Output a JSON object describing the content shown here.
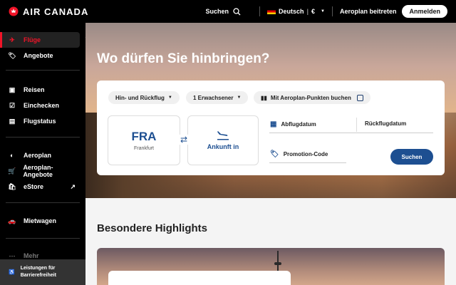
{
  "header": {
    "brand": "AIR CANADA",
    "search_label": "Suchen",
    "language": "Deutsch",
    "currency": "€",
    "aeroplan_join": "Aeroplan beitreten",
    "login": "Anmelden"
  },
  "sidebar": {
    "items": [
      {
        "label": "Flüge",
        "icon": "plane-icon"
      },
      {
        "label": "Angebote",
        "icon": "tag-icon"
      },
      {
        "label": "Reisen",
        "icon": "suitcase-icon"
      },
      {
        "label": "Einchecken",
        "icon": "checkin-icon"
      },
      {
        "label": "Flugstatus",
        "icon": "status-icon"
      },
      {
        "label": "Aeroplan",
        "icon": "aeroplan-icon"
      },
      {
        "label": "Aeroplan-Angebote",
        "icon": "cart-icon"
      },
      {
        "label": "eStore",
        "icon": "bag-icon"
      },
      {
        "label": "Mietwagen",
        "icon": "car-icon"
      },
      {
        "label": "Mehr",
        "icon": "more-icon"
      }
    ],
    "accessibility": "Leistungen für Barrierefreiheit"
  },
  "hero": {
    "title": "Wo dürfen Sie hinbringen?"
  },
  "booking": {
    "trip_type": "Hin- und Rückflug",
    "passengers": "1 Erwachsener",
    "aeroplan_points": "Mit Aeroplan-Punkten buchen",
    "origin_code": "FRA",
    "origin_city": "Frankfurt",
    "arrival_label": "Ankunft in",
    "departure_date": "Abflugdatum",
    "return_date": "Rückflugdatum",
    "promo_code": "Promotion-Code",
    "search_button": "Suchen"
  },
  "highlights": {
    "title": "Besondere Highlights"
  },
  "colors": {
    "brand_red": "#f01428",
    "accent_blue": "#1d4f91"
  }
}
